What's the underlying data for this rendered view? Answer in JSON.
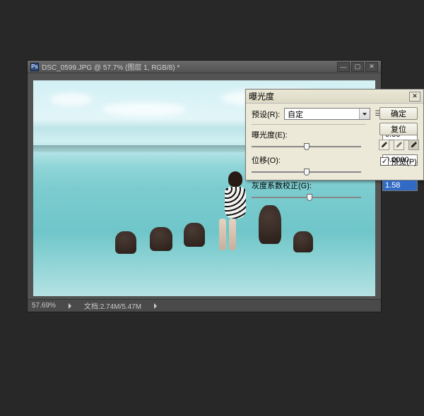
{
  "window": {
    "title": "DSC_0599.JPG @ 57.7% (图层 1, RGB/8) *",
    "status": {
      "zoom": "57.69%",
      "doc_label": "文档:2.74M/5.47M"
    }
  },
  "dialog": {
    "title": "曝光度",
    "preset_label": "预设(R):",
    "preset_value": "自定",
    "exposure_label": "曝光度(E):",
    "exposure_value": "0.00",
    "offset_label": "位移(O):",
    "offset_value": "0.0000",
    "gamma_label": "灰度系数校正(G):",
    "gamma_value": "1.58",
    "ok_label": "确定",
    "reset_label": "复位",
    "preview_label": "预览(P)",
    "preview_checked": true
  },
  "slider_positions": {
    "exposure": 50,
    "offset": 50,
    "gamma": 53
  }
}
